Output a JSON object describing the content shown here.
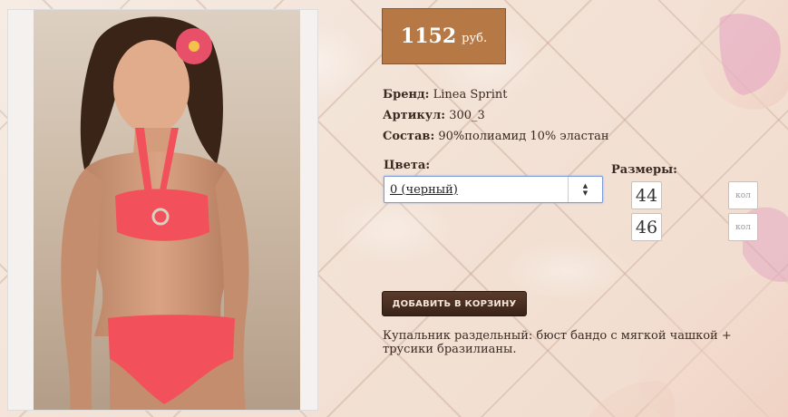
{
  "price": {
    "value": "1152",
    "currency": "руб."
  },
  "product": {
    "brand_label": "Бренд:",
    "brand": "Linea Sprint",
    "sku_label": "Артикул:",
    "sku": "300_3",
    "composition_label": "Состав:",
    "composition": "90%полиамид 10% эластан"
  },
  "colors": {
    "label": "Цвета:",
    "selected": "0 (черный)"
  },
  "sizes": {
    "label": "Размеры:",
    "items": [
      {
        "size": "44",
        "qty_placeholder": "кол"
      },
      {
        "size": "46",
        "qty_placeholder": "кол"
      }
    ]
  },
  "cart": {
    "button_label": "ДОБАВИТЬ В КОРЗИНУ"
  },
  "description": "Купальник раздельный: бюст бандо с мягкой чашкой + трусики бразилианы.",
  "colors_theme": {
    "price_bg": "#b67845",
    "button_bg": "#4a2e20",
    "swimsuit": "#f2505a",
    "bg": "#f3e3d7"
  }
}
